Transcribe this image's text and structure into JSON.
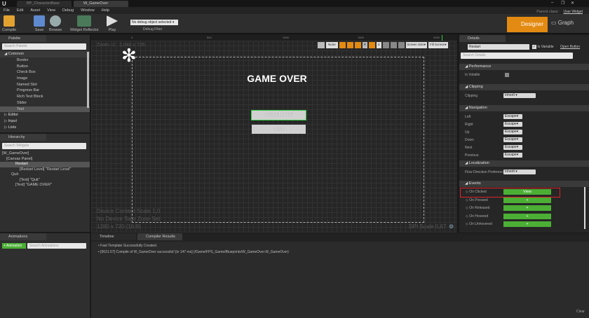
{
  "window": {
    "tabs": [
      "BP_CharacterBase",
      "W_GameOver"
    ],
    "parent_class_label": "Parent class:",
    "parent_class": "User Widget"
  },
  "menu": [
    "File",
    "Edit",
    "Asset",
    "View",
    "Debug",
    "Window",
    "Help"
  ],
  "toolbar": {
    "compile": "Compile",
    "save": "Save",
    "browse": "Browse",
    "widget_reflector": "Widget Reflector",
    "play": "Play",
    "debug_object": "No debug object selected",
    "debug_filter": "Debug Filter",
    "designer": "Designer",
    "graph": "Graph"
  },
  "palette": {
    "tab": "Palette",
    "search_placeholder": "Search Palette",
    "category": "Common",
    "items": [
      "Border",
      "Button",
      "Check Box",
      "Image",
      "Named Slot",
      "Progress Bar",
      "Rich Text Block",
      "Slider",
      "Text"
    ],
    "selected": "Text",
    "other_categories": [
      "Editor",
      "Input",
      "Lists"
    ]
  },
  "hierarchy": {
    "tab": "Hierarchy",
    "search_placeholder": "Search Widgets",
    "items": [
      "[W_GameOver]",
      "[Canvas Panel]",
      "Restart",
      "[Restart Level] \"Restart Level\"",
      "Quit",
      "[Text] \"Quit\"",
      "[Text] \"GAME OVER\""
    ],
    "selected": "Restart"
  },
  "designer": {
    "zoom": "Zoom -2",
    "size": "1,040 x 726",
    "ruler": [
      "0",
      "500",
      "1000",
      "1500",
      "2000"
    ],
    "controls": {
      "none": "None",
      "r": "R",
      "four": "4",
      "screen_size": "Screen Size",
      "fill_screen": "Fill Screen"
    },
    "title_text": "GAME OVER",
    "restart_button": "Restart Level",
    "quit_button": "Quit",
    "device_scale": "Device Content Scale 1,0",
    "safe_zone": "No Device Safe Zone Set",
    "resolution": "1280 x 720 (16:9)",
    "dpi": "DPI Scale 0,67"
  },
  "details": {
    "tab": "Details",
    "name": "Restart",
    "is_variable": "Is Variable",
    "is_variable_checked": true,
    "open_button": "Open Button",
    "search_placeholder": "Search Details",
    "sections": {
      "performance": "Performance",
      "is_volatile": "Is Volatile",
      "clipping": "Clipping",
      "clipping_label": "Clipping",
      "clipping_value": "Inherit",
      "navigation": "Navigation",
      "localization": "Localization",
      "flow_label": "Flow Direction Preference",
      "flow_value": "Inherit",
      "events": "Events"
    },
    "nav": [
      {
        "label": "Left",
        "value": "Escape"
      },
      {
        "label": "Right",
        "value": "Escape"
      },
      {
        "label": "Up",
        "value": "Escape"
      },
      {
        "label": "Down",
        "value": "Escape"
      },
      {
        "label": "Next",
        "value": "Escape"
      },
      {
        "label": "Previous",
        "value": "Escape"
      }
    ],
    "events": [
      {
        "label": "On Clicked",
        "button": "View"
      },
      {
        "label": "On Pressed",
        "button": "+"
      },
      {
        "label": "On Released",
        "button": "+"
      },
      {
        "label": "On Hovered",
        "button": "+"
      },
      {
        "label": "On Unhovered",
        "button": "+"
      }
    ],
    "highlight_color": "#e0222a"
  },
  "animations": {
    "tab": "Animations",
    "add": "+ Animation",
    "search_placeholder": "Search Animations"
  },
  "bottom": {
    "tabs": [
      "Timeline",
      "Compiler Results"
    ],
    "log": [
      "Fast Template Successfully Created.",
      "[0621.57] Compile of W_GameOver successful! [in 147 ms] (/Game/FPS_Game/Blueprints/W_GameOver.W_GameOver)"
    ],
    "clear": "Clear"
  },
  "colors": {
    "accent": "#e38a12",
    "event_green": "#4caf35",
    "selection_green": "#2ecc40"
  }
}
